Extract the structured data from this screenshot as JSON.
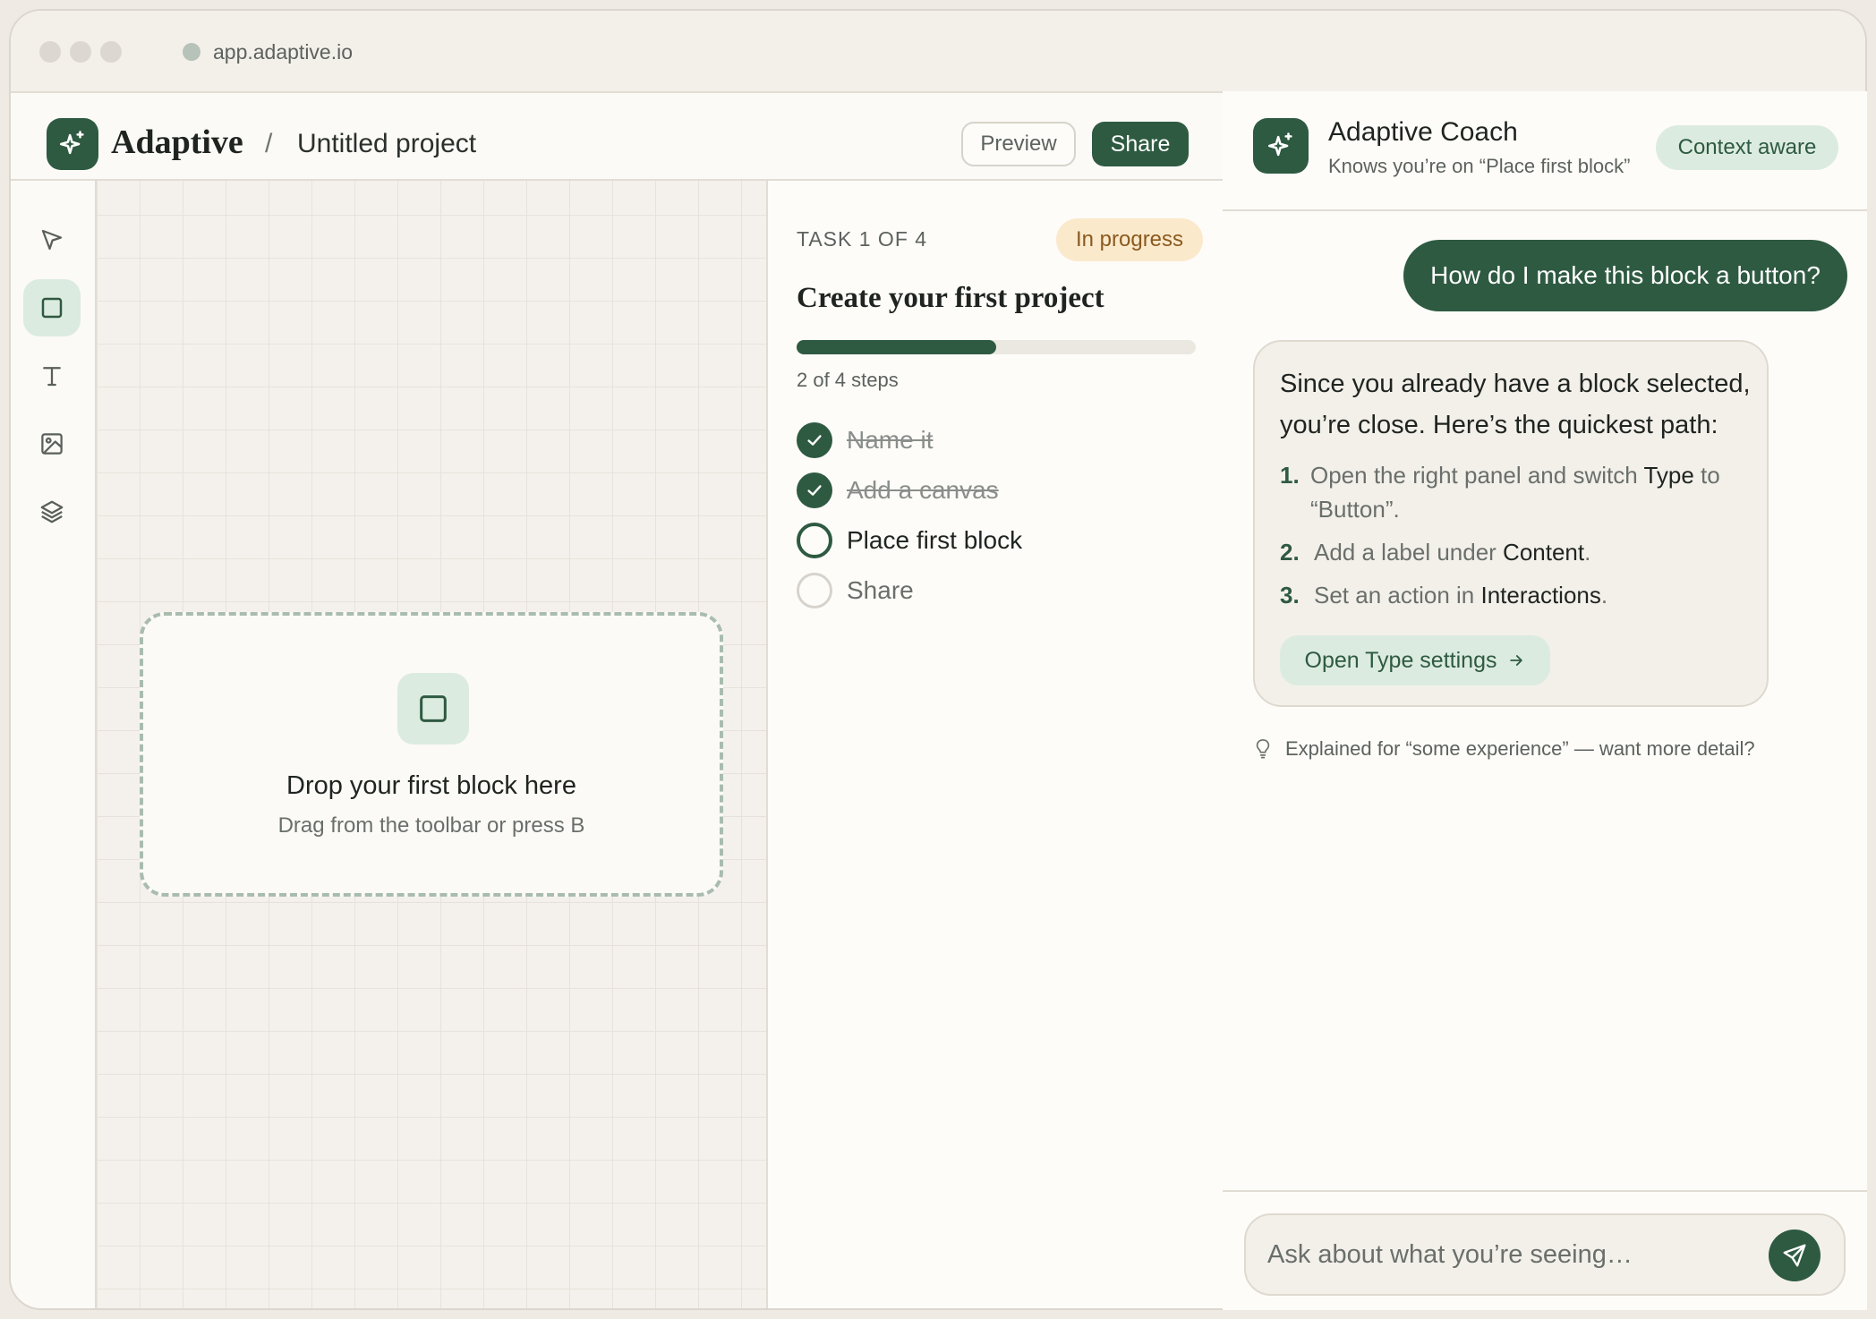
{
  "browser": {
    "url": "app.adaptive.io"
  },
  "header": {
    "brand": "Adaptive",
    "separator": "/",
    "project_title": "Untitled project",
    "preview_label": "Preview",
    "share_label": "Share"
  },
  "toolbar": {
    "tools": [
      {
        "name": "select",
        "icon": "pointer-icon"
      },
      {
        "name": "block",
        "icon": "square-icon",
        "active": true
      },
      {
        "name": "text",
        "icon": "text-icon"
      },
      {
        "name": "image",
        "icon": "image-icon"
      },
      {
        "name": "layers",
        "icon": "layers-icon"
      }
    ]
  },
  "canvas": {
    "drop_title": "Drop your first block here",
    "drop_subtitle": "Drag from the toolbar or press B"
  },
  "task": {
    "label": "TASK 1 OF 4",
    "status": "In progress",
    "title": "Create your first project",
    "progress_fraction": 0.5,
    "progress_text": "2 of 4 steps",
    "steps": [
      {
        "label": "Name it",
        "state": "done"
      },
      {
        "label": "Add a canvas",
        "state": "done"
      },
      {
        "label": "Place first block",
        "state": "current"
      },
      {
        "label": "Share",
        "state": "todo"
      }
    ]
  },
  "coach": {
    "name": "Adaptive Coach",
    "subtitle": "Knows you’re on “Place first block”",
    "badge": "Context aware",
    "user_message": "How do I make this block a button?",
    "reply": {
      "intro": "Since you already have a block selected, you’re close. Here’s the quickest path:",
      "steps": [
        {
          "num": "1.",
          "prefix": "Open the right panel and switch ",
          "code": "Type",
          "suffix": " to “Button”."
        },
        {
          "num": "2.",
          "prefix": "Add a label under ",
          "code": "Content",
          "suffix": "."
        },
        {
          "num": "3.",
          "prefix": "Set an action in ",
          "code": "Interactions",
          "suffix": "."
        }
      ],
      "action_label": "Open Type settings",
      "action_icon": "arrow-right-icon"
    },
    "hint": "Explained for “some experience” — want more detail?",
    "hint_icon": "lightbulb-icon",
    "composer_placeholder": "Ask about what you’re seeing…",
    "send_icon": "send-icon"
  },
  "colors": {
    "brand_green": "#2e5a41",
    "accent_mint": "#dcebe0",
    "status_amber_bg": "#fbe9cc",
    "status_amber_text": "#8a5a1e"
  }
}
